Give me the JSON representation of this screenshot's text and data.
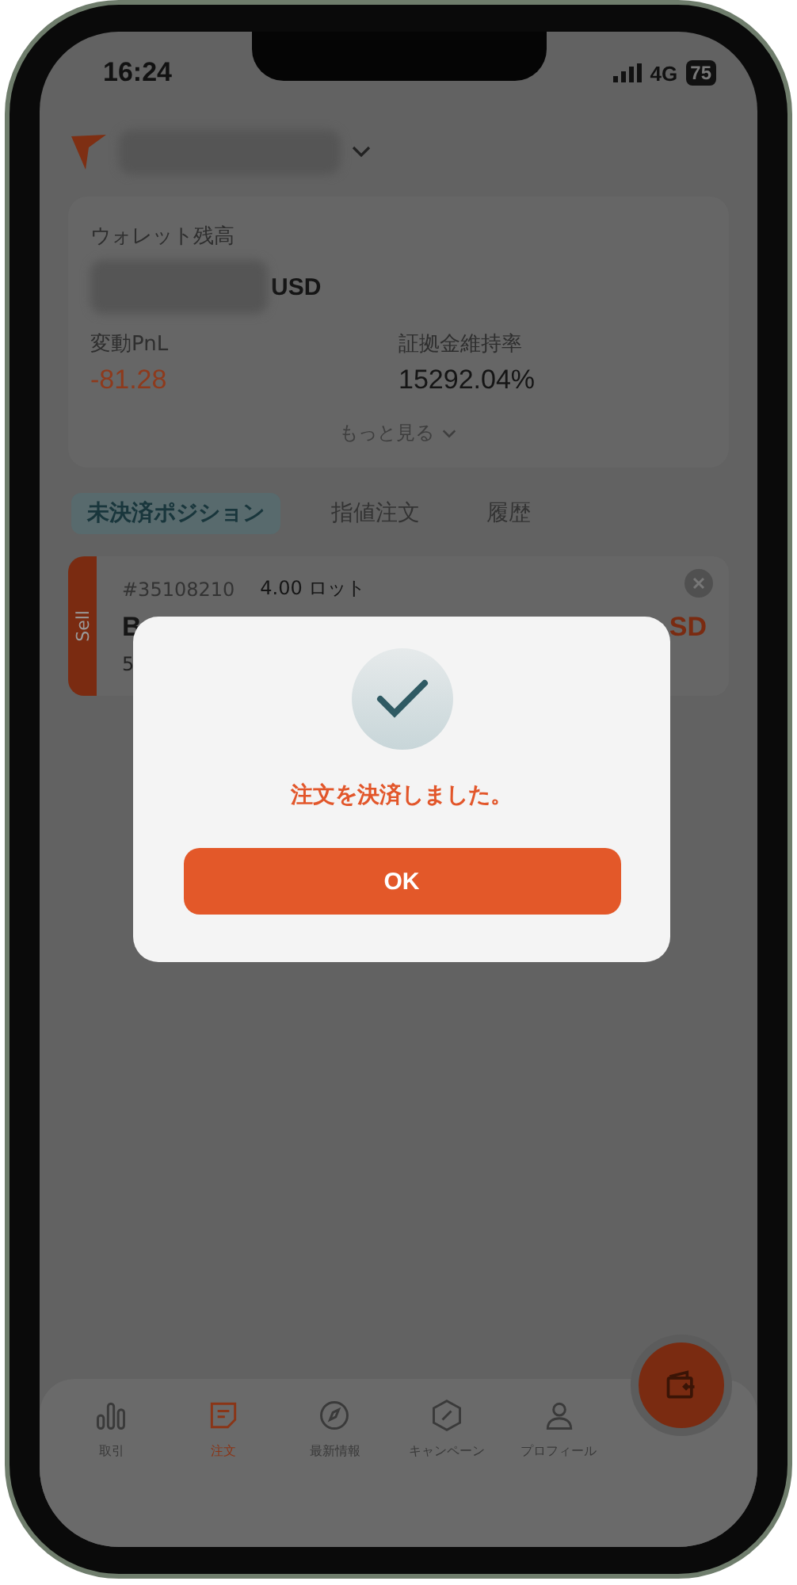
{
  "status_bar": {
    "time": "16:24",
    "network": "4G",
    "battery": "75"
  },
  "wallet": {
    "label": "ウォレット残高",
    "currency": "USD"
  },
  "stats": [
    {
      "label": "変動PnL",
      "value": "-81.28",
      "kind": "loss"
    },
    {
      "label": "証拠金維持率",
      "value": "15292.04%",
      "kind": "plain"
    }
  ],
  "more_link": "もっと見る",
  "tabs": [
    {
      "label": "未決済ポジション",
      "selected": true
    },
    {
      "label": "指値注文",
      "selected": false
    },
    {
      "label": "履歴",
      "selected": false
    }
  ],
  "position": {
    "side": "Sell",
    "id": "#35108210",
    "lots": "4.00 ロット",
    "symbol_part": "B",
    "amount_part": "SD",
    "detail_part": "5"
  },
  "dialog": {
    "message": "注文を決済しました。",
    "button": "OK"
  },
  "nav": [
    {
      "label": "取引",
      "kind": "chart",
      "selected": false
    },
    {
      "label": "注文",
      "kind": "order",
      "selected": true
    },
    {
      "label": "最新情報",
      "kind": "compass",
      "selected": false
    },
    {
      "label": "キャンペーン",
      "kind": "coupon",
      "selected": false
    },
    {
      "label": "プロフィール",
      "kind": "person",
      "selected": false
    }
  ]
}
